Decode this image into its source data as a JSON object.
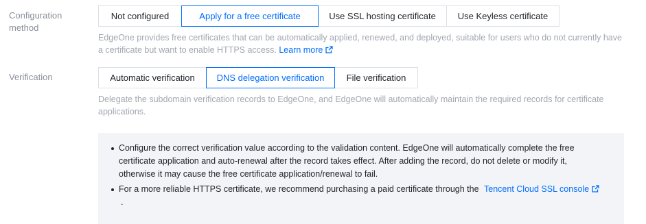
{
  "config_method": {
    "label": "Configuration method",
    "options": [
      "Not configured",
      "Apply for a free certificate",
      "Use SSL hosting certificate",
      "Use Keyless certificate"
    ],
    "selected": "Apply for a free certificate",
    "description": "EdgeOne provides free certificates that can be automatically applied, renewed, and deployed, suitable for users who do not currently have a certificate but want to enable HTTPS access.",
    "learn_more": "Learn more"
  },
  "verification": {
    "label": "Verification",
    "options": [
      "Automatic verification",
      "DNS delegation verification",
      "File verification"
    ],
    "selected": "DNS delegation verification",
    "description": "Delegate the subdomain verification records to EdgeOne, and EdgeOne will automatically maintain the required records for certificate applications."
  },
  "notice": {
    "item1": "Configure the correct verification value according to the validation content. EdgeOne will automatically complete the free certificate application and auto-renewal after the record takes effect. After adding the record, do not delete or modify it, otherwise it may cause the free certificate application/renewal to fail.",
    "item2_prefix": "For a more reliable HTTPS certificate, we recommend purchasing a paid certificate through the",
    "item2_link": "Tencent Cloud SSL console",
    "item2_suffix": "."
  },
  "colors": {
    "accent": "#006eff",
    "muted_text": "#a2a7b0",
    "label_text": "#8a8f99",
    "notice_bg": "#f3f4f7"
  },
  "icons": {
    "external_link": "external-link-icon",
    "bullet": "bullet-dot"
  }
}
